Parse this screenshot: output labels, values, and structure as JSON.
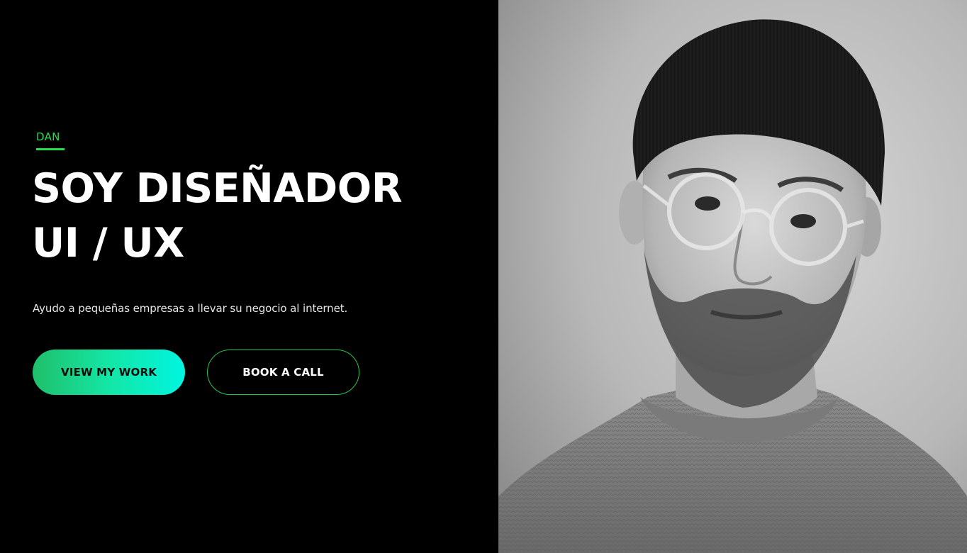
{
  "hero": {
    "eyebrow": "DAN",
    "headline_line1": "SOY DISEÑADOR",
    "headline_line2": "UI / UX",
    "subtitle": "Ayudo a pequeñas empresas a llevar su negocio al internet.",
    "primary_button_label": "VIEW MY WORK",
    "secondary_button_label": "BOOK A CALL"
  },
  "colors": {
    "background": "#000000",
    "accent_green": "#22e04a",
    "gradient_start": "#1fbf6a",
    "gradient_end": "#00f5e0",
    "text_primary": "#ffffff"
  },
  "portrait": {
    "alt": "Black and white portrait photo"
  }
}
